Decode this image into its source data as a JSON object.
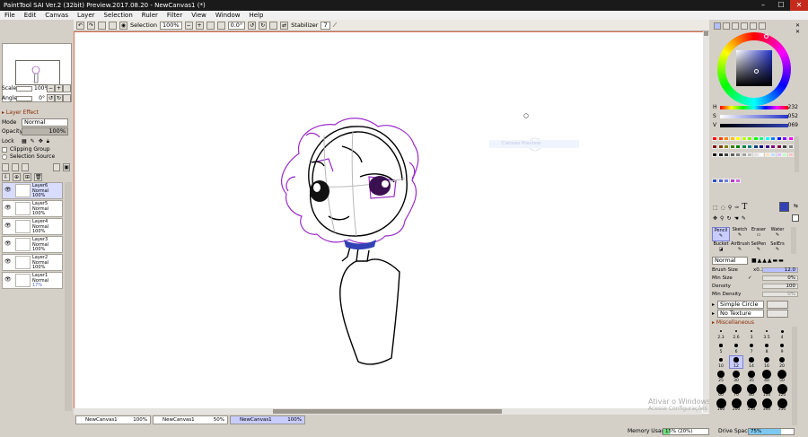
{
  "window": {
    "title": "PaintTool SAI Ver.2 (32bit) Preview.2017.08.20 - NewCanvas1 (*)",
    "minimize": "–",
    "maximize": "☐",
    "close": "✕"
  },
  "menu": [
    "File",
    "Edit",
    "Canvas",
    "Layer",
    "Selection",
    "Ruler",
    "Filter",
    "View",
    "Window",
    "Help"
  ],
  "toolbar": {
    "selection_label": "Selection",
    "zoom": "100%",
    "angle": "0.0°",
    "stabilizer_label": "Stabilizer",
    "stabilizer_value": "7"
  },
  "left": {
    "scale_label": "Scale",
    "scale_value": "100%",
    "angle_label": "Angle",
    "angle_value": "0°",
    "layer_effect": "Layer Effect",
    "mode_label": "Mode",
    "mode_value": "Normal",
    "opacity_label": "Opacity",
    "opacity_value": "100%",
    "lock_label": "Lock",
    "clipping_group": "Clipping Group",
    "selection_source": "Selection Source"
  },
  "layers": [
    {
      "name": "Layer6",
      "mode": "Normal",
      "opacity": "100%",
      "selected": true
    },
    {
      "name": "Layer5",
      "mode": "Normal",
      "opacity": "100%",
      "selected": false
    },
    {
      "name": "Layer4",
      "mode": "Normal",
      "opacity": "100%",
      "selected": false
    },
    {
      "name": "Layer3",
      "mode": "Normal",
      "opacity": "100%",
      "selected": false
    },
    {
      "name": "Layer2",
      "mode": "Normal",
      "opacity": "100%",
      "selected": false
    },
    {
      "name": "Layer1",
      "mode": "Normal",
      "opacity": "17%",
      "selected": false
    }
  ],
  "canvas_tabs": [
    {
      "name": "NewCanvas1",
      "zoom": "100%",
      "active": false
    },
    {
      "name": "NewCanvas1",
      "zoom": "50%",
      "active": false
    },
    {
      "name": "NewCanvas1",
      "zoom": "100%",
      "active": true
    }
  ],
  "ghost_tooltip": "Canvas Preview",
  "status": {
    "memory_label": "Memory Usage",
    "memory_value": "15% (20%)",
    "memory_fill": 0.15,
    "drive_label": "Drive Space",
    "drive_value": "75%",
    "drive_fill": 0.75
  },
  "watermark": {
    "line1": "Ativar o Windows",
    "line2": "Acesse Configurações"
  },
  "color": {
    "h_label": "H",
    "h_value": "232",
    "s_label": "S",
    "s_value": "052",
    "v_label": "V",
    "v_value": "069",
    "current": "#3242b4",
    "swatches_row1": [
      "#ff0000",
      "#ff4000",
      "#ff8000",
      "#ffc000",
      "#ffff00",
      "#c0ff00",
      "#80ff00",
      "#00ff00",
      "#00ff80",
      "#00ffff",
      "#0080ff",
      "#0000ff",
      "#8000ff",
      "#ff00ff"
    ],
    "swatches_row2": [
      "#800000",
      "#804000",
      "#808000",
      "#408000",
      "#008000",
      "#008040",
      "#008080",
      "#004080",
      "#000080",
      "#400080",
      "#800080",
      "#800040",
      "#404040",
      "#808080"
    ],
    "swatches_row3": [
      "#000000",
      "#202020",
      "#404040",
      "#606060",
      "#808080",
      "#a0a0a0",
      "#c0c0c0",
      "#e0e0e0",
      "#ffffff",
      "#ffe0c0",
      "#c0e0ff",
      "#e0c0ff",
      "#c0ffc0",
      "#ffc0c0"
    ],
    "swatches_row4": [
      "#3050c0",
      "#5060d0",
      "#7080e0",
      "#b040c0",
      "#d060e0"
    ]
  },
  "tools": {
    "brushes": [
      "Pencil",
      "Sketch",
      "Eraser",
      "Water",
      "Bucket",
      "AirBrush",
      "SelPen",
      "SelErs"
    ],
    "blend_mode": "Normal",
    "brush_size_label": "Brush Size",
    "brush_size_mult": "x0.1",
    "brush_size_value": "12.0",
    "min_size_label": "Min Size",
    "min_size_value": "0%",
    "density_label": "Density",
    "density_value": "100",
    "min_density_label": "Min Density",
    "min_density_value": "0%",
    "shape": "Simple Circle",
    "texture": "No Texture",
    "misc_label": "Miscellaneous",
    "size_labels": [
      "2.3",
      "2.6",
      "3",
      "3.5",
      "4",
      "5",
      "6",
      "7",
      "8",
      "9",
      "10",
      "12",
      "14",
      "16",
      "20",
      "25",
      "30",
      "35",
      "40",
      "50",
      "60",
      "70",
      "80",
      "100",
      "120",
      "160",
      "200",
      "250",
      "300",
      "350"
    ],
    "selected_size": "12"
  }
}
